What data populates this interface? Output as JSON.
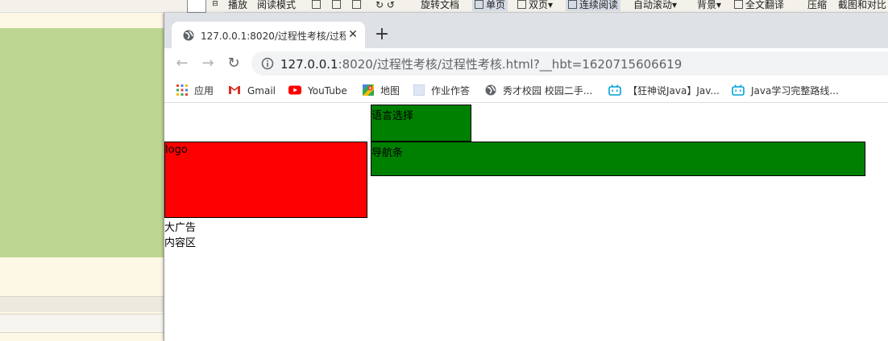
{
  "background_app": {
    "toolbar": [
      {
        "label": "播放",
        "pressed": false
      },
      {
        "label": "阅读模式",
        "pressed": false
      },
      {
        "label": "旋转文档",
        "pressed": false
      },
      {
        "label": "单页",
        "pressed": true
      },
      {
        "label": "双页",
        "pressed": false
      },
      {
        "label": "连续阅读",
        "pressed": true
      },
      {
        "label": "自动滚动",
        "pressed": false
      },
      {
        "label": "背景",
        "pressed": false
      },
      {
        "label": "全文翻译",
        "pressed": false
      },
      {
        "label": "压缩",
        "pressed": false
      },
      {
        "label": "截图和对比",
        "pressed": false
      }
    ],
    "green_panel_color": "#bdd691"
  },
  "browser": {
    "tab": {
      "title": "127.0.0.1:8020/过程性考核/过程",
      "close_glyph": "✕"
    },
    "new_tab_glyph": "+",
    "nav": {
      "back": "←",
      "forward": "→",
      "reload": "↻"
    },
    "url": {
      "host": "127.0.0.1",
      "rest": ":8020/过程性考核/过程性考核.html?__hbt=1620715606619"
    },
    "bookmarks": [
      {
        "label": "应用",
        "icon": "apps-grid-icon"
      },
      {
        "label": "Gmail",
        "icon": "gmail-icon"
      },
      {
        "label": "YouTube",
        "icon": "youtube-icon"
      },
      {
        "label": "地图",
        "icon": "maps-icon"
      },
      {
        "label": "作业作答",
        "icon": "page-icon"
      },
      {
        "label": "秀才校园 校园二手...",
        "icon": "globe-icon"
      },
      {
        "label": "【狂神说Java】Jav...",
        "icon": "bilibili-icon"
      },
      {
        "label": "Java学习完整路线...",
        "icon": "bilibili-icon"
      }
    ]
  },
  "page": {
    "lang_select": {
      "text": "语言选择",
      "color": "#008000"
    },
    "logo": {
      "text": "logo",
      "color": "#ff0000"
    },
    "navbar": {
      "text": "导航条",
      "color": "#008000"
    },
    "big_ad": "大广告",
    "content_area": "内容区"
  }
}
